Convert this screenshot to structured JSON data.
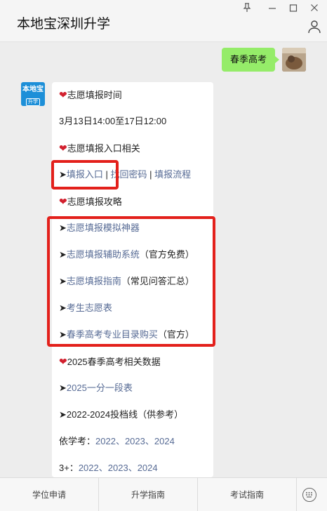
{
  "window": {
    "title": "本地宝深圳升学",
    "pin_icon": "pin-icon",
    "minimize_icon": "minimize-icon",
    "maximize_icon": "maximize-icon",
    "close_icon": "close-icon",
    "profile_icon": "person-icon"
  },
  "chat": {
    "user_message": "春季高考",
    "bot_avatar": {
      "line1": "本地宝",
      "line2": "升学"
    },
    "reply": {
      "l1": "志愿填报时间",
      "l2": "3月13日14:00至17日12:00",
      "l3": "志愿填报入口相关",
      "l4": {
        "arrow": "➤",
        "a": "填报入口",
        "sep1": " | ",
        "b": "找回密码",
        "sep2": " | ",
        "c": "填报流程"
      },
      "l5": "志愿填报攻略",
      "l6": {
        "arrow": "➤",
        "text": "志愿填报模拟神器"
      },
      "l7": {
        "arrow": "➤",
        "text": "志愿填报辅助系统",
        "suffix": "（官方免费）"
      },
      "l8": {
        "arrow": "➤",
        "text": "志愿填报指南",
        "suffix": "（常见问答汇总）"
      },
      "l9": {
        "arrow": "➤",
        "text": "考生志愿表"
      },
      "l10": {
        "arrow": "➤",
        "text": "春季高考专业目录购买",
        "suffix": "（官方）"
      },
      "l11": "2025春季高考相关数据",
      "l12": {
        "arrow": "➤",
        "text": "2025一分一段表"
      },
      "l13": {
        "arrow": "➤",
        "text": "2022-2024投档线（供参考）"
      },
      "l14": {
        "prefix": "依学考：",
        "y1": "2022",
        "d1": "、",
        "y2": "2023",
        "d2": "、",
        "y3": "2024"
      },
      "l15": {
        "prefix": "3+：",
        "y1": "2022",
        "d1": "、",
        "y2": "2023",
        "d2": "、",
        "y3": "2024"
      },
      "heart": "❤"
    }
  },
  "bottom_menu": {
    "items": [
      "学位申请",
      "升学指南",
      "考试指南"
    ],
    "keyboard_icon": "keyboard-icon"
  },
  "colors": {
    "link": "#576b95",
    "highlight": "#e3201b",
    "user_bubble": "#95ec69"
  }
}
